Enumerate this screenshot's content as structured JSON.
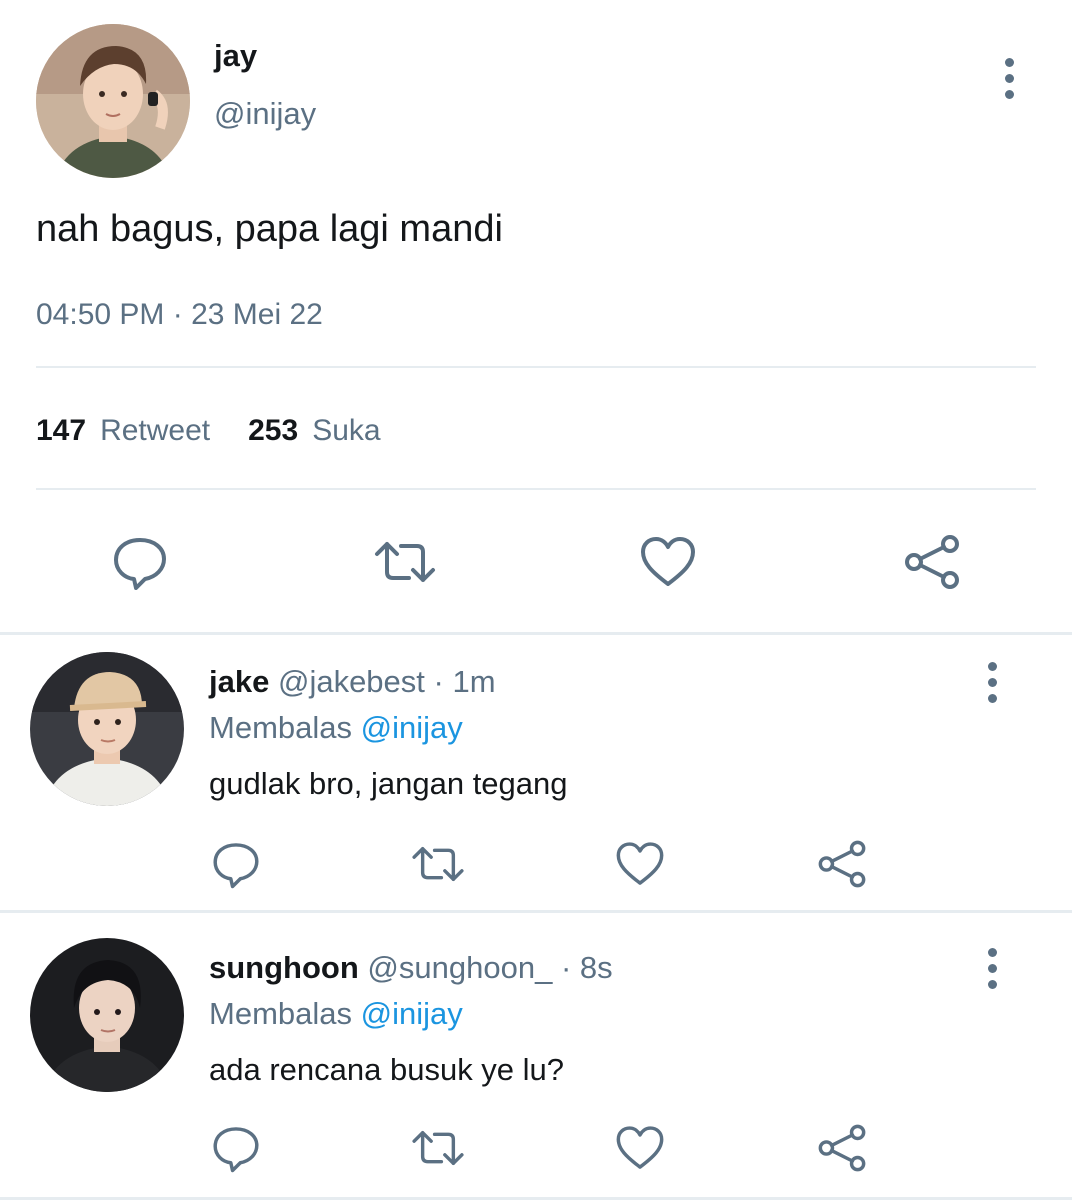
{
  "main_tweet": {
    "display_name": "jay",
    "handle": "@inijay",
    "text": "nah bagus, papa lagi mandi",
    "timestamp": "04:50 PM · 23 Mei 22",
    "retweet_count": "147",
    "retweet_label": "Retweet",
    "like_count": "253",
    "like_label": "Suka"
  },
  "replies": [
    {
      "display_name": "jake",
      "handle": "@jakebest",
      "separator": "·",
      "time": "1m",
      "context_prefix": "Membalas",
      "context_mention": "@inijay",
      "text": "gudlak bro, jangan tegang"
    },
    {
      "display_name": "sunghoon",
      "handle": "@sunghoon_",
      "separator": "·",
      "time": "8s",
      "context_prefix": "Membalas",
      "context_mention": "@inijay",
      "text": "ada rencana busuk ye lu?"
    }
  ],
  "icons": {
    "reply": "speech-bubble-icon",
    "retweet": "retweet-icon",
    "like": "heart-icon",
    "share": "share-icon",
    "more": "vertical-ellipsis-icon"
  },
  "colors": {
    "text_primary": "#14171a",
    "text_secondary": "#5b7083",
    "mention": "#1b95e0",
    "divider": "#e6ecf0"
  }
}
